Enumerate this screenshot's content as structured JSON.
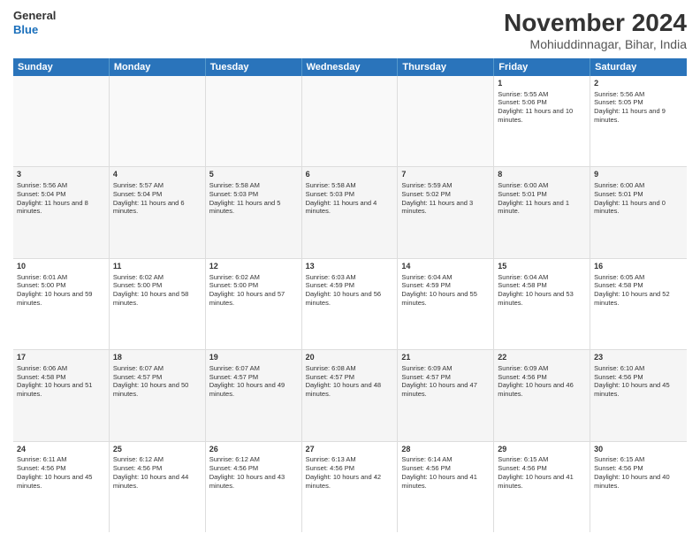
{
  "logo": {
    "line1": "General",
    "line2": "Blue"
  },
  "title": "November 2024",
  "subtitle": "Mohiuddinnagar, Bihar, India",
  "days_of_week": [
    "Sunday",
    "Monday",
    "Tuesday",
    "Wednesday",
    "Thursday",
    "Friday",
    "Saturday"
  ],
  "weeks": [
    [
      {
        "day": "",
        "info": ""
      },
      {
        "day": "",
        "info": ""
      },
      {
        "day": "",
        "info": ""
      },
      {
        "day": "",
        "info": ""
      },
      {
        "day": "",
        "info": ""
      },
      {
        "day": "1",
        "info": "Sunrise: 5:55 AM\nSunset: 5:06 PM\nDaylight: 11 hours and 10 minutes."
      },
      {
        "day": "2",
        "info": "Sunrise: 5:56 AM\nSunset: 5:05 PM\nDaylight: 11 hours and 9 minutes."
      }
    ],
    [
      {
        "day": "3",
        "info": "Sunrise: 5:56 AM\nSunset: 5:04 PM\nDaylight: 11 hours and 8 minutes."
      },
      {
        "day": "4",
        "info": "Sunrise: 5:57 AM\nSunset: 5:04 PM\nDaylight: 11 hours and 6 minutes."
      },
      {
        "day": "5",
        "info": "Sunrise: 5:58 AM\nSunset: 5:03 PM\nDaylight: 11 hours and 5 minutes."
      },
      {
        "day": "6",
        "info": "Sunrise: 5:58 AM\nSunset: 5:03 PM\nDaylight: 11 hours and 4 minutes."
      },
      {
        "day": "7",
        "info": "Sunrise: 5:59 AM\nSunset: 5:02 PM\nDaylight: 11 hours and 3 minutes."
      },
      {
        "day": "8",
        "info": "Sunrise: 6:00 AM\nSunset: 5:01 PM\nDaylight: 11 hours and 1 minute."
      },
      {
        "day": "9",
        "info": "Sunrise: 6:00 AM\nSunset: 5:01 PM\nDaylight: 11 hours and 0 minutes."
      }
    ],
    [
      {
        "day": "10",
        "info": "Sunrise: 6:01 AM\nSunset: 5:00 PM\nDaylight: 10 hours and 59 minutes."
      },
      {
        "day": "11",
        "info": "Sunrise: 6:02 AM\nSunset: 5:00 PM\nDaylight: 10 hours and 58 minutes."
      },
      {
        "day": "12",
        "info": "Sunrise: 6:02 AM\nSunset: 5:00 PM\nDaylight: 10 hours and 57 minutes."
      },
      {
        "day": "13",
        "info": "Sunrise: 6:03 AM\nSunset: 4:59 PM\nDaylight: 10 hours and 56 minutes."
      },
      {
        "day": "14",
        "info": "Sunrise: 6:04 AM\nSunset: 4:59 PM\nDaylight: 10 hours and 55 minutes."
      },
      {
        "day": "15",
        "info": "Sunrise: 6:04 AM\nSunset: 4:58 PM\nDaylight: 10 hours and 53 minutes."
      },
      {
        "day": "16",
        "info": "Sunrise: 6:05 AM\nSunset: 4:58 PM\nDaylight: 10 hours and 52 minutes."
      }
    ],
    [
      {
        "day": "17",
        "info": "Sunrise: 6:06 AM\nSunset: 4:58 PM\nDaylight: 10 hours and 51 minutes."
      },
      {
        "day": "18",
        "info": "Sunrise: 6:07 AM\nSunset: 4:57 PM\nDaylight: 10 hours and 50 minutes."
      },
      {
        "day": "19",
        "info": "Sunrise: 6:07 AM\nSunset: 4:57 PM\nDaylight: 10 hours and 49 minutes."
      },
      {
        "day": "20",
        "info": "Sunrise: 6:08 AM\nSunset: 4:57 PM\nDaylight: 10 hours and 48 minutes."
      },
      {
        "day": "21",
        "info": "Sunrise: 6:09 AM\nSunset: 4:57 PM\nDaylight: 10 hours and 47 minutes."
      },
      {
        "day": "22",
        "info": "Sunrise: 6:09 AM\nSunset: 4:56 PM\nDaylight: 10 hours and 46 minutes."
      },
      {
        "day": "23",
        "info": "Sunrise: 6:10 AM\nSunset: 4:56 PM\nDaylight: 10 hours and 45 minutes."
      }
    ],
    [
      {
        "day": "24",
        "info": "Sunrise: 6:11 AM\nSunset: 4:56 PM\nDaylight: 10 hours and 45 minutes."
      },
      {
        "day": "25",
        "info": "Sunrise: 6:12 AM\nSunset: 4:56 PM\nDaylight: 10 hours and 44 minutes."
      },
      {
        "day": "26",
        "info": "Sunrise: 6:12 AM\nSunset: 4:56 PM\nDaylight: 10 hours and 43 minutes."
      },
      {
        "day": "27",
        "info": "Sunrise: 6:13 AM\nSunset: 4:56 PM\nDaylight: 10 hours and 42 minutes."
      },
      {
        "day": "28",
        "info": "Sunrise: 6:14 AM\nSunset: 4:56 PM\nDaylight: 10 hours and 41 minutes."
      },
      {
        "day": "29",
        "info": "Sunrise: 6:15 AM\nSunset: 4:56 PM\nDaylight: 10 hours and 41 minutes."
      },
      {
        "day": "30",
        "info": "Sunrise: 6:15 AM\nSunset: 4:56 PM\nDaylight: 10 hours and 40 minutes."
      }
    ]
  ]
}
